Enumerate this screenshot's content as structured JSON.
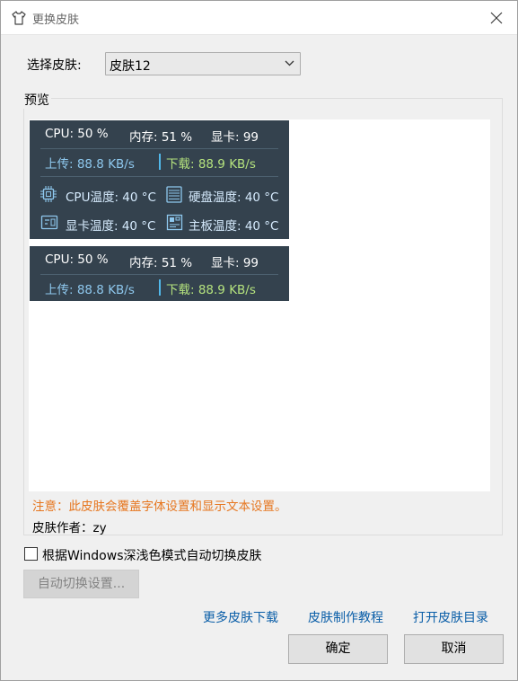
{
  "window": {
    "title": "更换皮肤"
  },
  "form": {
    "skin_label": "选择皮肤:",
    "skin_value": "皮肤12",
    "preview_label": "预览"
  },
  "preview": {
    "panel1": {
      "cpu": "CPU: 50 %",
      "mem": "内存: 51 %",
      "gpu": "显卡: 99",
      "upload": "上传: 88.8 KB/s",
      "download": "下载: 88.9 KB/s",
      "cpu_temp": "CPU温度: 40 °C",
      "disk_temp": "硬盘温度: 40 °C",
      "gpu_temp": "显卡温度: 40 °C",
      "board_temp": "主板温度: 40 °C"
    },
    "panel2": {
      "cpu": "CPU: 50 %",
      "mem": "内存: 51 %",
      "gpu": "显卡: 99",
      "upload": "上传: 88.8 KB/s",
      "download": "下载: 88.9 KB/s"
    }
  },
  "note": "注意：此皮肤会覆盖字体设置和显示文本设置。",
  "author": "皮肤作者：zy",
  "auto_switch": {
    "checkbox_label": "根据Windows深浅色模式自动切换皮肤",
    "checked": false,
    "settings_button": "自动切换设置..."
  },
  "links": {
    "more": "更多皮肤下载",
    "tutorial": "皮肤制作教程",
    "open_dir": "打开皮肤目录"
  },
  "buttons": {
    "ok": "确定",
    "cancel": "取消"
  },
  "colors": {
    "panel_bg": "#34424e",
    "upload_text": "#8ec8ee",
    "download_text": "#b5e37e",
    "note_text": "#e6761f",
    "link_text": "#0a5ea8"
  }
}
